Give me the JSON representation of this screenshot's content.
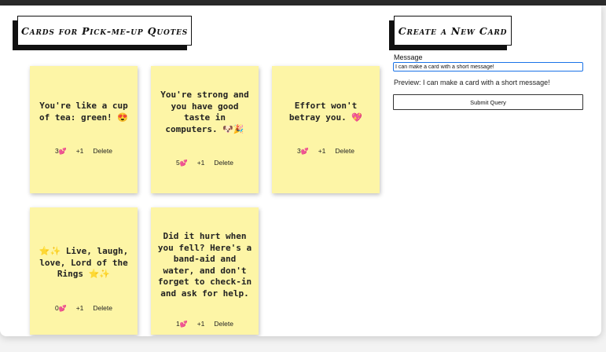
{
  "left_title": "Cards for Pick-me-up Quotes",
  "right_title": "Create a New Card",
  "form": {
    "message_label": "Message",
    "message_value": "I can make a card with a short message!",
    "preview_prefix": "Preview: ",
    "preview_text": "I can make a card with a short message!",
    "submit_label": "Submit Query"
  },
  "cards": [
    {
      "text": "You're like a cup of tea: green! 😍",
      "likes": "3",
      "plus_label": "+1",
      "delete_label": "Delete"
    },
    {
      "text": "You're strong and you have good taste in computers. 🐶🎉",
      "likes": "5",
      "plus_label": "+1",
      "delete_label": "Delete"
    },
    {
      "text": "Effort won't betray you. 💖",
      "likes": "3",
      "plus_label": "+1",
      "delete_label": "Delete"
    },
    {
      "text": "⭐✨ Live, laugh, love, Lord of the Rings ⭐✨",
      "likes": "0",
      "plus_label": "+1",
      "delete_label": "Delete"
    },
    {
      "text": "Did it hurt when you fell? Here's a band-aid and water, and don't forget to check-in and ask for help.",
      "likes": "1",
      "plus_label": "+1",
      "delete_label": "Delete"
    }
  ],
  "heart_icon": "💕",
  "colors": {
    "card_bg": "#fdf5a6",
    "focus_border": "#1a73e8"
  }
}
